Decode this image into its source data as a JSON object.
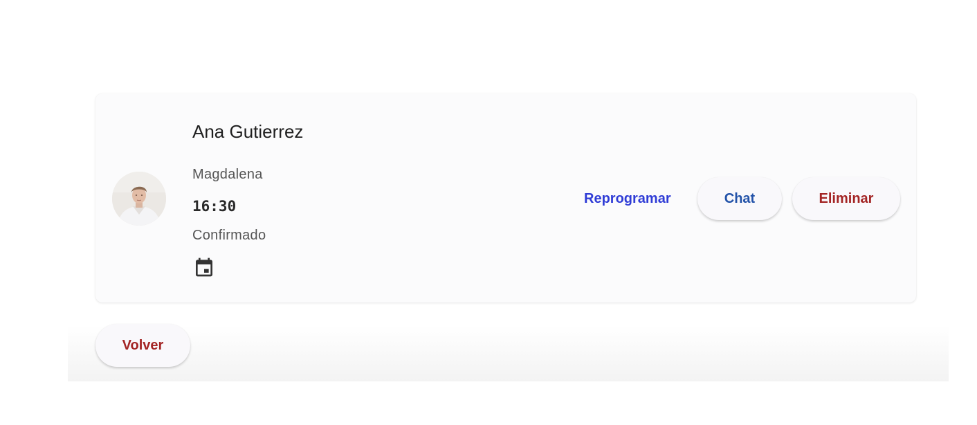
{
  "appointment": {
    "name": "Ana Gutierrez",
    "place": "Magdalena",
    "time": "16:30",
    "status": "Confirmado",
    "icon": "calendar-icon"
  },
  "actions": {
    "reschedule_label": "Reprogramar",
    "chat_label": "Chat",
    "delete_label": "Eliminar"
  },
  "navigation": {
    "back_label": "Volver"
  },
  "colors": {
    "reschedule": "#2f3cd6",
    "chat": "#2252a8",
    "danger": "#a32424",
    "card_background": "#fbfbfc"
  }
}
